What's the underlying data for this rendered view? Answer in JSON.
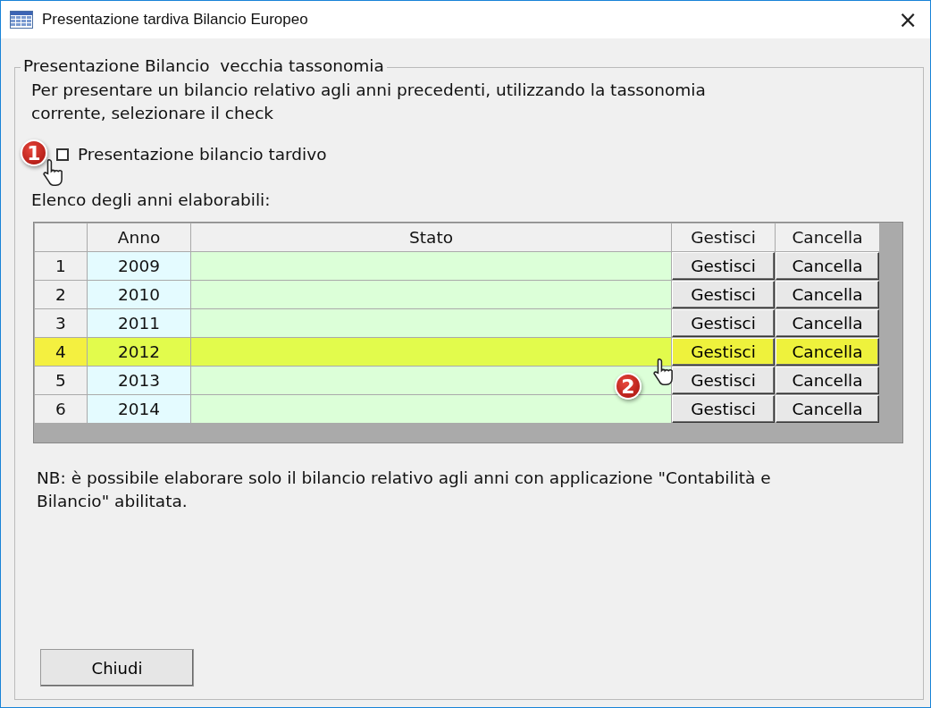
{
  "window": {
    "title": "Presentazione tardiva Bilancio Europeo",
    "close": "×"
  },
  "group": {
    "title": "Presentazione Bilancio  vecchia tassonomia",
    "intro": "Per presentare un bilancio relativo agli anni precedenti, utilizzando la tassonomia corrente, selezionare il check",
    "checkbox": {
      "label": "Presentazione bilancio tardivo",
      "checked": false,
      "badge": "1"
    },
    "list_label": "Elenco degli anni elaborabili:",
    "table": {
      "columns": [
        "Anno",
        "Stato",
        "Gestisci",
        "Cancella"
      ],
      "rows": [
        {
          "number": "1",
          "anno": "2009",
          "gestisci": "Gestisci",
          "cancella": "Cancella",
          "selected": false
        },
        {
          "number": "2",
          "anno": "2010",
          "gestisci": "Gestisci",
          "cancella": "Cancella",
          "selected": false
        },
        {
          "number": "3",
          "anno": "2011",
          "gestisci": "Gestisci",
          "cancella": "Cancella",
          "selected": false
        },
        {
          "number": "4",
          "anno": "2012",
          "gestisci": "Gestisci",
          "cancella": "Cancella",
          "selected": true
        },
        {
          "number": "5",
          "anno": "2013",
          "gestisci": "Gestisci",
          "cancella": "Cancella",
          "selected": false
        },
        {
          "number": "6",
          "anno": "2014",
          "gestisci": "Gestisci",
          "cancella": "Cancella",
          "selected": false
        }
      ],
      "badge": "2"
    },
    "note": "NB: è possibile elaborare solo il bilancio relativo agli anni con applicazione \"Contabilità e Bilancio\" abilitata.",
    "buttons": [
      "Chiudi"
    ]
  }
}
